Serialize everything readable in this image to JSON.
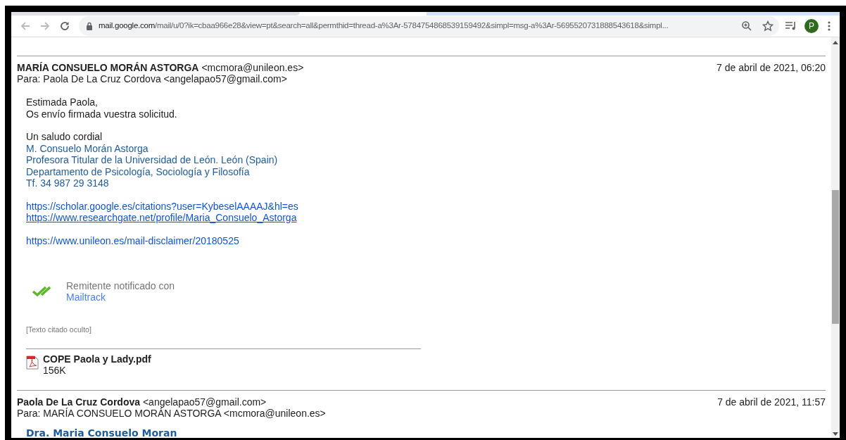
{
  "browser": {
    "url_host": "mail.google.com",
    "url_rest": "/mail/u/0?ik=cbaa966e28&view=pt&search=all&permthid=thread-a%3Ar-5784754868539159492&simpl=msg-a%3Ar-5695520731888543618&simpl...",
    "avatar_letter": "P"
  },
  "messages": [
    {
      "from_name": "MARÍA CONSUELO MORÁN ASTORGA",
      "from_email": "<mcmora@unileon.es>",
      "to": "Para: Paola De La Cruz Cordova <angelapao57@gmail.com>",
      "date": "7 de abril de 2021, 06:20",
      "paragraphs": [
        {
          "lines": [
            {
              "kind": "plain",
              "text": "Estimada Paola,"
            },
            {
              "kind": "plain",
              "text": "Os envío firmada vuestra solicitud."
            }
          ]
        },
        {
          "lines": [
            {
              "kind": "plain",
              "text": "Un saludo cordial"
            },
            {
              "kind": "signature",
              "text": "M. Consuelo Morán Astorga"
            },
            {
              "kind": "signature",
              "text": "Profesora Titular de la Universidad de León. León (Spain)"
            },
            {
              "kind": "signature",
              "text": "Departamento de Psicología, Sociología y Filosofía"
            },
            {
              "kind": "signature",
              "text": "Tf. 34 987 29 3148"
            }
          ]
        },
        {
          "lines": [
            {
              "kind": "link",
              "text": "https://scholar.google.es/citations?user=KybeselAAAAJ&hl=es"
            },
            {
              "kind": "underlined_link",
              "text": "https://www.researchgate.net/profile/Maria_Consuelo_Astorga"
            }
          ]
        },
        {
          "lines": [
            {
              "kind": "link",
              "text": "https://www.unileon.es/mail-disclaimer/20180525"
            }
          ]
        }
      ],
      "mailtrack": {
        "text": "Remitente notificado con",
        "link": "Mailtrack"
      },
      "quoted_toggle": "[Texto citado oculto]",
      "attachment": {
        "name": "COPE Paola y Lady.pdf",
        "size": "156K"
      }
    },
    {
      "from_name": "Paola De La Cruz Cordova",
      "from_email": "<angelapao57@gmail.com>",
      "to": "Para: MARÍA CONSUELO MORÁN ASTORGA <mcmora@unileon.es>",
      "date": "7 de abril de 2021, 11:57",
      "paragraphs": [
        {
          "lines": [
            {
              "kind": "heading",
              "text": "Dra. Maria Consuelo Moran"
            }
          ]
        }
      ]
    }
  ]
}
